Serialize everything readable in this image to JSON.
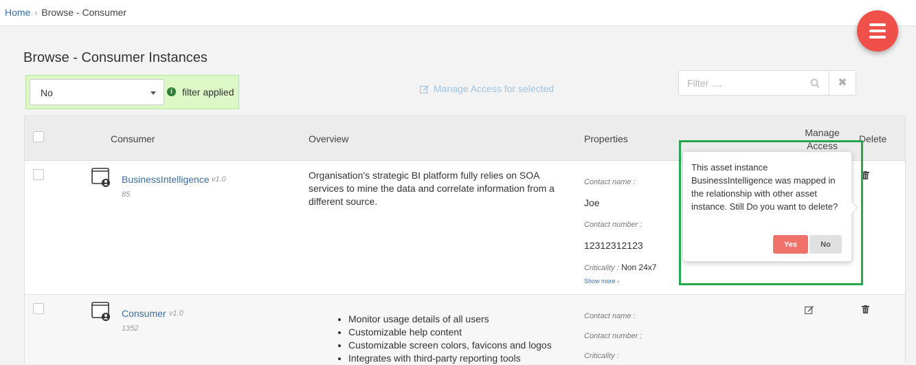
{
  "breadcrumb": {
    "home": "Home",
    "separator": "›",
    "current": "Browse - Consumer"
  },
  "page": {
    "title": "Browse - Consumer Instances"
  },
  "filter": {
    "selected": "No",
    "status": "filter applied",
    "status_color": "#2e7d32",
    "panel_color": "#dcf8c6"
  },
  "toolbar": {
    "manage_access_selected": "Manage Access for selected",
    "filter_placeholder": "Filter ....",
    "clear_label": "✖"
  },
  "table": {
    "headers": {
      "consumer": "Consumer",
      "overview": "Overview",
      "properties": "Properties",
      "manage_access": "Manage Access",
      "delete": "Delete"
    },
    "rows": [
      {
        "name": "BusinessIntelligence",
        "version": "v1.0",
        "count": "85",
        "overview": "Organisation's strategic BI platform fully relies on SOA services to mine the data and correlate information from a different source.",
        "contact_name_label": "Contact name :",
        "contact_name": "Joe",
        "contact_number_label": "Contact number :",
        "contact_number": "12312312123",
        "criticality_label": "Criticality :",
        "criticality": "Non 24x7",
        "show_more": "Show more ›"
      },
      {
        "name": "Consumer",
        "version": "v1.0",
        "count": "1352",
        "overview_items": [
          "Monitor usage details of all users",
          "Customizable help content",
          "Customizable screen colors, favicons and logos",
          "Integrates with third-party reporting tools"
        ],
        "contact_name_label": "Contact name :",
        "contact_number_label": "Contact number :",
        "criticality_label": "Criticality :"
      }
    ]
  },
  "popover": {
    "message": "This asset instance BusinessIntelligence was mapped in the relationship with other asset instance. Still Do you want to delete?",
    "yes": "Yes",
    "no": "No"
  },
  "icons": {
    "menu": "hamburger-menu-icon",
    "info": "info-circle-icon",
    "edit": "edit-pencil-icon",
    "search": "search-icon",
    "clear": "close-x-icon",
    "trash": "trash-icon",
    "app": "application-user-icon"
  },
  "colors": {
    "accent": "#f0504a",
    "link": "#3a6ea5",
    "yes_button": "#f0706a",
    "highlight": "#22a84a"
  }
}
